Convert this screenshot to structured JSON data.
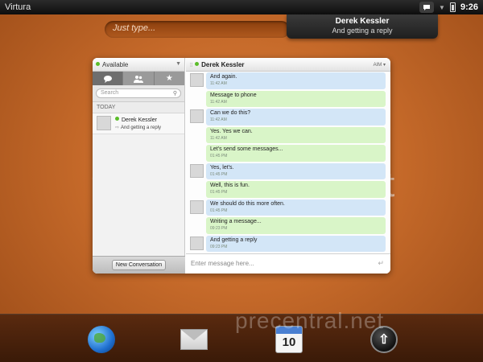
{
  "statusbar": {
    "carrier": "Virtura",
    "time": "9:26",
    "icons": [
      "chat-bubble-icon",
      "chevron-down-icon",
      "battery-icon"
    ]
  },
  "notification": {
    "title": "Derek Kessler",
    "text": "And getting a reply"
  },
  "search": {
    "placeholder": "Just type..."
  },
  "buddy_list": {
    "status_label": "Available",
    "tabs": [
      "chat-icon",
      "contacts-icon",
      "star-icon"
    ],
    "search_placeholder": "Search",
    "section": "TODAY",
    "contacts": [
      {
        "name": "Derek Kessler",
        "last_message": "And getting a reply"
      }
    ],
    "new_conversation_label": "New Conversation"
  },
  "conversation": {
    "contact_name": "Derek Kessler",
    "service": "AIM",
    "messages": [
      {
        "direction": "in",
        "text": "And again.",
        "time": "11:42 AM"
      },
      {
        "direction": "out",
        "text": "Message to phone",
        "time": "11:42 AM"
      },
      {
        "direction": "in",
        "text": "Can we do this?",
        "time": "11:42 AM"
      },
      {
        "direction": "out",
        "text": "Yes. Yes we can.",
        "time": "11:42 AM"
      },
      {
        "direction": "out",
        "text": "Let's send some messages...",
        "time": "01:45 PM"
      },
      {
        "direction": "in",
        "text": "Yes, let's.",
        "time": "01:45 PM"
      },
      {
        "direction": "out",
        "text": "Well, this is fun.",
        "time": "01:45 PM"
      },
      {
        "direction": "in",
        "text": "We should do this more often.",
        "time": "01:45 PM"
      },
      {
        "direction": "out",
        "text": "Writing a message...",
        "time": "09:23 PM"
      },
      {
        "direction": "in",
        "text": "And getting a reply",
        "time": "09:23 PM"
      }
    ],
    "compose_placeholder": "Enter message here..."
  },
  "dock": {
    "items": [
      "web-browser-icon",
      "email-icon",
      "calendar-icon",
      "launcher-icon"
    ],
    "calendar_day": "10"
  },
  "watermark": "precentral.net",
  "colors": {
    "wallpaper": "#c66a2a",
    "incoming_bubble": "#d3e6f7",
    "outgoing_bubble": "#d9f5c8",
    "online_status": "#5bbd2a"
  }
}
